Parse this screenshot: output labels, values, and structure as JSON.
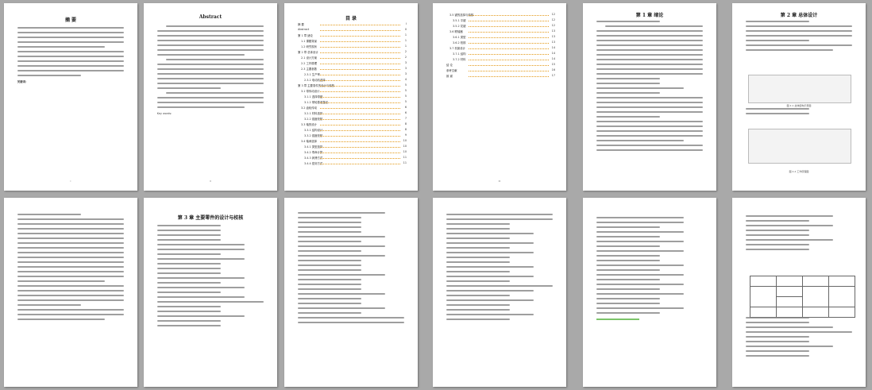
{
  "pages": [
    {
      "id": "p1",
      "title": "摘  要",
      "keywords_label": "关键词："
    },
    {
      "id": "p2",
      "title": "Abstract",
      "keywords_label": "Key words:"
    },
    {
      "id": "p3",
      "title": "目  录"
    },
    {
      "id": "p4"
    },
    {
      "id": "p5",
      "title": "第 1 章  绪论"
    },
    {
      "id": "p6",
      "title": "第 2 章  总体设计"
    },
    {
      "id": "p7"
    },
    {
      "id": "p8",
      "title": "第 3 章  主要零件的设计与校核"
    },
    {
      "id": "p9"
    },
    {
      "id": "p10"
    },
    {
      "id": "p11"
    },
    {
      "id": "p12"
    }
  ],
  "toc": {
    "first": [
      {
        "label": "摘 要",
        "page": "I"
      },
      {
        "label": "Abstract",
        "page": "II"
      },
      {
        "label": "第 1 章 绪论",
        "page": "1"
      },
      {
        "label": "1.1 课题背景",
        "page": "1"
      },
      {
        "label": "1.2 研究现状",
        "page": "1"
      },
      {
        "label": "第 2 章 总体设计",
        "page": "2"
      },
      {
        "label": "2.1 设计方案",
        "page": "2"
      },
      {
        "label": "2.2 工作原理",
        "page": "3"
      },
      {
        "label": "2.3 主要参数",
        "page": "3"
      },
      {
        "label": "2.3.1 生产率",
        "page": "3"
      },
      {
        "label": "2.3.2 电动机选择",
        "page": "4"
      },
      {
        "label": "第 3 章 主要零件的设计与校核",
        "page": "5"
      },
      {
        "label": "3.1 带传动设计",
        "page": "5"
      },
      {
        "label": "3.1.1 选择带型",
        "page": "5"
      },
      {
        "label": "3.1.2 带轮基准直径",
        "page": "5"
      },
      {
        "label": "3.2 齿轮传动",
        "page": "6"
      },
      {
        "label": "3.2.1 材料选择",
        "page": "6"
      },
      {
        "label": "3.2.2 强度校核",
        "page": "7"
      },
      {
        "label": "3.3 轴的设计",
        "page": "8"
      },
      {
        "label": "3.3.1 结构设计",
        "page": "8"
      },
      {
        "label": "3.3.2 强度校核",
        "page": "9"
      },
      {
        "label": "3.4 轴承选择",
        "page": "10"
      },
      {
        "label": "3.4.1 类型选择",
        "page": "10"
      },
      {
        "label": "3.4.2 寿命计算",
        "page": "10"
      },
      {
        "label": "3.4.3 润滑方式",
        "page": "11"
      },
      {
        "label": "3.4.4 密封方式",
        "page": "11"
      }
    ],
    "second": [
      {
        "label": "3.5 键的选择与校核",
        "page": "12"
      },
      {
        "label": "3.5.1 平键",
        "page": "12"
      },
      {
        "label": "3.5.2 花键",
        "page": "12"
      },
      {
        "label": "3.6 联轴器",
        "page": "13"
      },
      {
        "label": "3.6.1 类型",
        "page": "13"
      },
      {
        "label": "3.6.2 校核",
        "page": "13"
      },
      {
        "label": "3.7 机架设计",
        "page": "14"
      },
      {
        "label": "3.7.1 结构",
        "page": "14"
      },
      {
        "label": "3.7.2 材料",
        "page": "14"
      },
      {
        "label": "结  论",
        "page": "15"
      },
      {
        "label": "参考文献",
        "page": "16"
      },
      {
        "label": "致  谢",
        "page": "17"
      }
    ]
  },
  "figures": {
    "fig_2_1": "图 2-1 总体结构示意图",
    "fig_2_2": "图 2-2 工作原理图"
  }
}
